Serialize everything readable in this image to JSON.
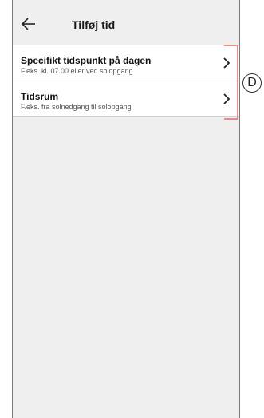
{
  "header": {
    "title": "Tilføj tid",
    "back_icon": "arrow-left-icon"
  },
  "options": [
    {
      "title": "Specifikt tidspunkt på dagen",
      "subtitle": "F.eks. kl. 07.00 eller ved solopgang",
      "icon": "chevron-right-icon"
    },
    {
      "title": "Tidsrum",
      "subtitle": "F.eks. fra solnedgang til solopgang",
      "icon": "chevron-right-icon"
    }
  ],
  "annotation": {
    "label": "D"
  },
  "colors": {
    "screen_background": "#efefef",
    "list_background": "#ffffff",
    "divider": "#cfcfcf",
    "accent_bracket": "#e06a6a"
  }
}
